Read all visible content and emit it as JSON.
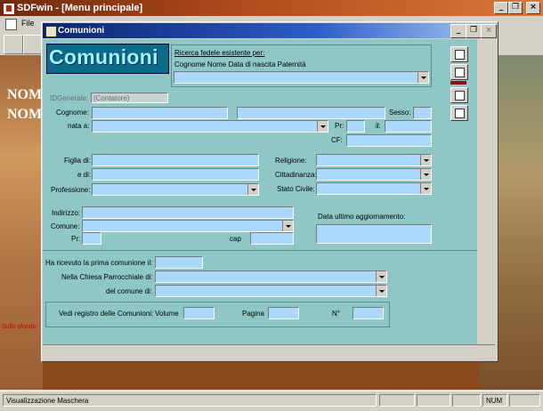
{
  "app": {
    "title": "SDFwin - [Menu principale]"
  },
  "menubar": {
    "file": "File"
  },
  "background": {
    "word1": "NOM",
    "word2": "NOM",
    "caption": "Sullo sfondo:"
  },
  "child": {
    "title": "Comunioni",
    "heading": "Comunioni",
    "search": {
      "line1": "Ricerca fedele esistente per:",
      "line2": "Cognome Nome Data di nascita Paternità"
    },
    "labels": {
      "idgenerale": "IDGenerale:",
      "contatore": "(Contatore)",
      "cognome": "Cognome:",
      "sesso": "Sesso:",
      "nata_a": "nata a:",
      "pr": "Pr:",
      "il": "il:",
      "cf": "CF:",
      "figlia_di": "Figlia di:",
      "e_di": "e di:",
      "professione": "Professione:",
      "religione": "Religione:",
      "cittadinanza": "Cittadinanza:",
      "stato_civile": "Stato Civile:",
      "indirizzo": "Indirizzo:",
      "comune": "Comune:",
      "pr2": "Pr:",
      "cap": "cap",
      "data_agg": "Data ultimo aggiornamento:",
      "prima_comunione": "Ha ricevuto la prima comunione il:",
      "chiesa": "Nella Chiesa Parrocchiale di:",
      "del_comune": "del comune di:",
      "registro": "Vedi registro delle Comunioni:",
      "volume": "Volume",
      "pagina": "Pagina",
      "numero": "N°"
    }
  },
  "statusbar": {
    "text": "Visualizzazione Maschera",
    "num": "NUM"
  },
  "colors": {
    "form_bg": "#8fc7c7",
    "field_bg": "#aad8ff",
    "title_blue": "#0a246a"
  }
}
